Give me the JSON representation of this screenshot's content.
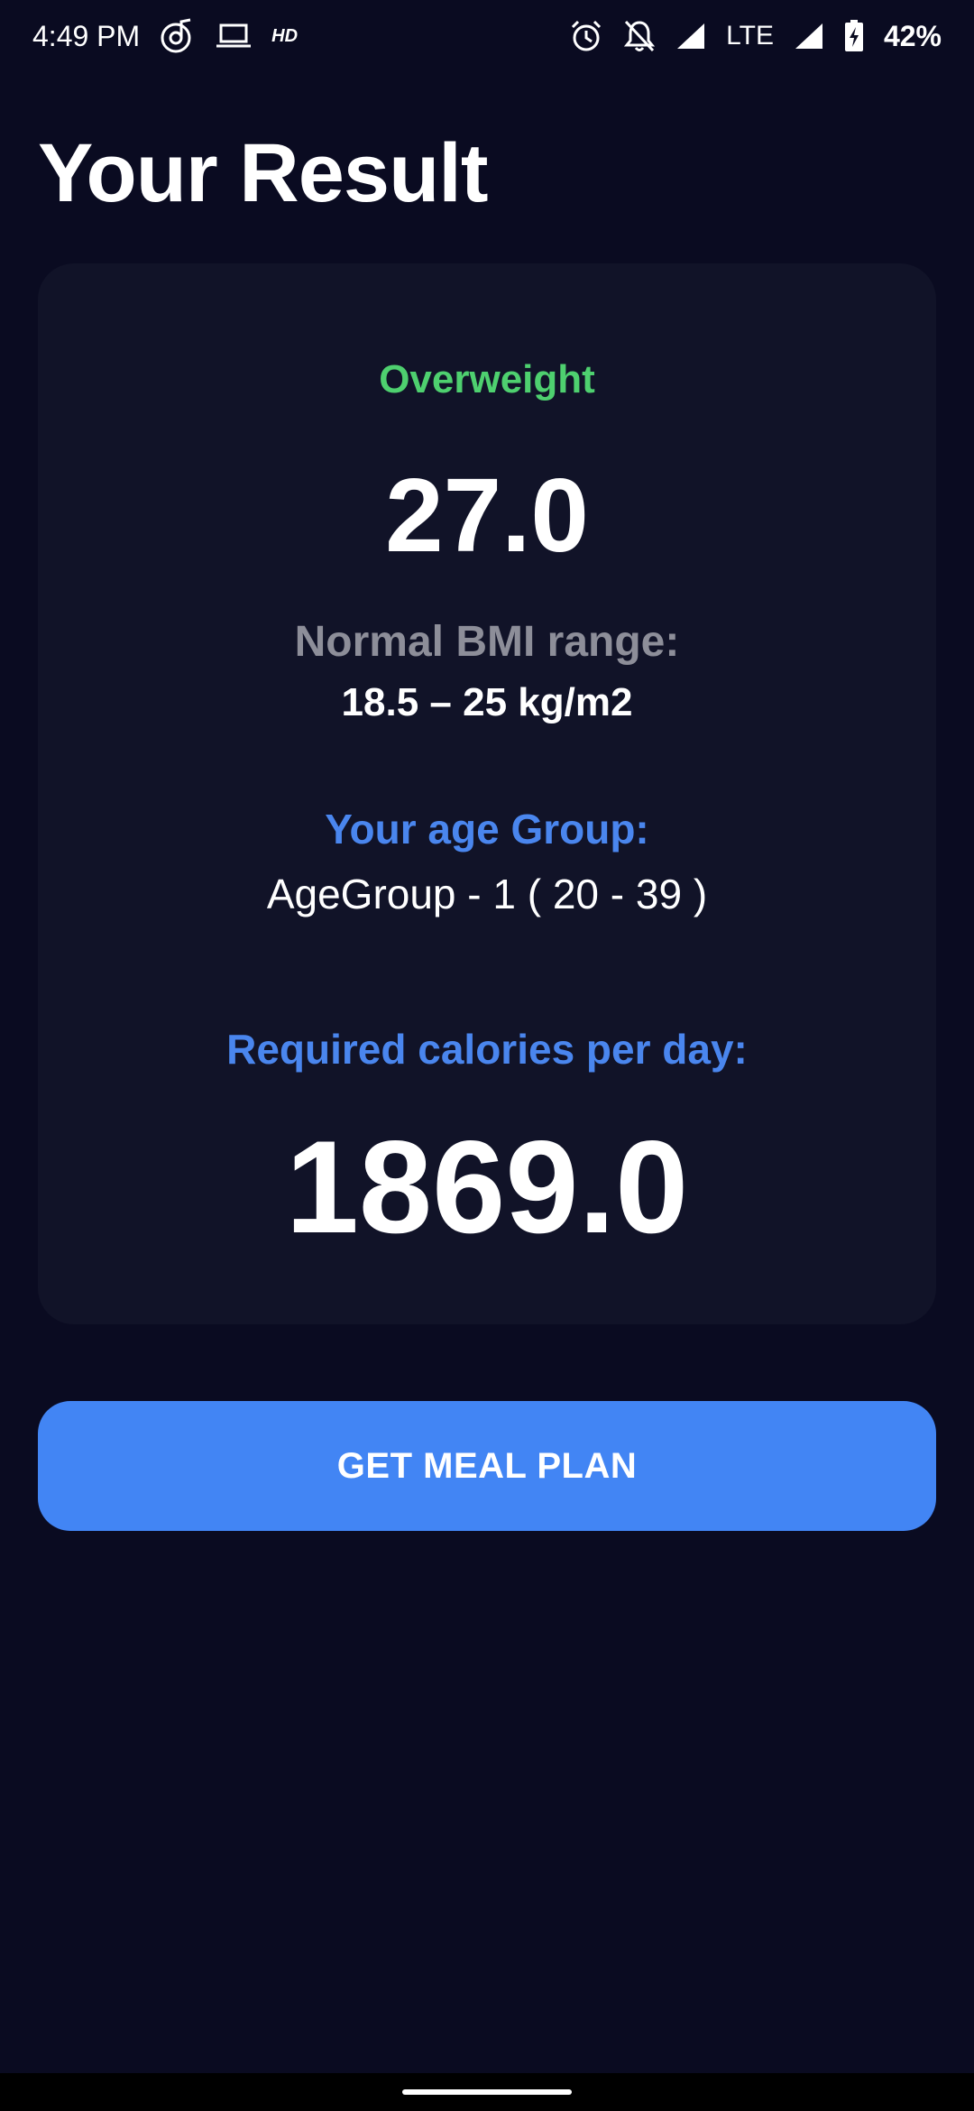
{
  "status_bar": {
    "time": "4:49 PM",
    "hd": "HD",
    "network": "LTE",
    "battery": "42%",
    "icons": [
      "music-note-icon",
      "laptop-icon",
      "hd-icon",
      "alarm-icon",
      "notifications-off-icon",
      "signal-icon",
      "battery-charging-icon"
    ]
  },
  "page": {
    "title": "Your Result"
  },
  "result": {
    "status": "Overweight",
    "bmi": "27.0",
    "range_label": "Normal BMI range:",
    "range_value": "18.5 – 25 kg/m2",
    "age_label": "Your age Group:",
    "age_value": "AgeGroup - 1 ( 20 - 39 )",
    "calories_label": "Required calories per day:",
    "calories_value": "1869.0"
  },
  "actions": {
    "meal_plan_label": "GET MEAL PLAN"
  },
  "colors": {
    "background": "#0a0b21",
    "card": "#111328",
    "status_green": "#4ed06f",
    "accent_blue": "#4a86ee",
    "button_blue": "#4285f4",
    "muted_gray": "#8d8e99"
  }
}
